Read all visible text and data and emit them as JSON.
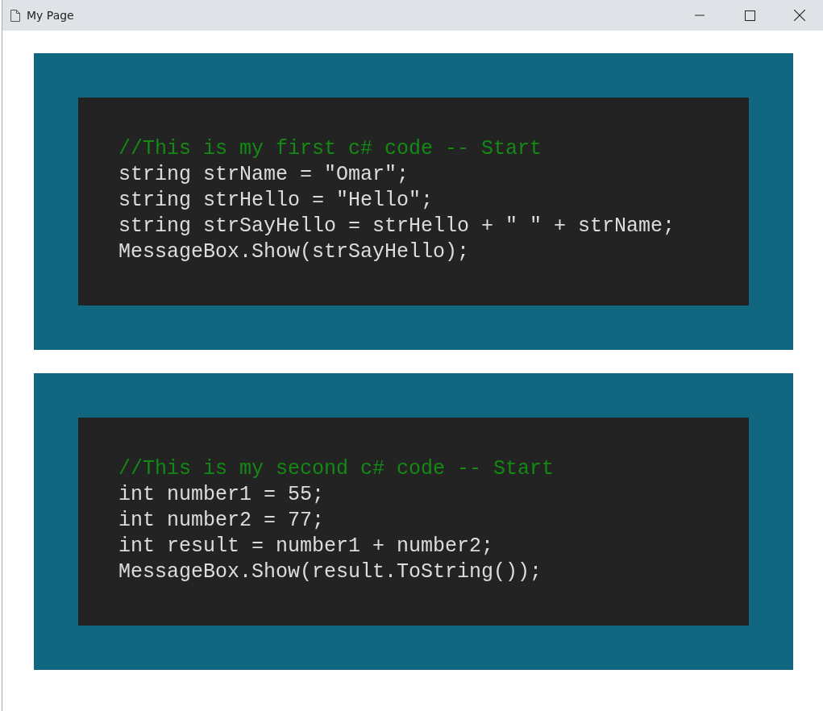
{
  "window": {
    "title": "My Page"
  },
  "code_blocks": [
    {
      "lines": [
        {
          "kind": "comment",
          "text": "//This is my first c# code -- Start"
        },
        {
          "kind": "code",
          "text": "string strName = \"Omar\";"
        },
        {
          "kind": "code",
          "text": "string strHello = \"Hello\";"
        },
        {
          "kind": "code",
          "text": "string strSayHello = strHello + \" \" + strName;"
        },
        {
          "kind": "code",
          "text": "MessageBox.Show(strSayHello);"
        }
      ]
    },
    {
      "lines": [
        {
          "kind": "comment",
          "text": "//This is my second c# code -- Start"
        },
        {
          "kind": "code",
          "text": "int number1 = 55;"
        },
        {
          "kind": "code",
          "text": "int number2 = 77;"
        },
        {
          "kind": "code",
          "text": "int result = number1 + number2;"
        },
        {
          "kind": "code",
          "text": "MessageBox.Show(result.ToString());"
        }
      ]
    }
  ]
}
